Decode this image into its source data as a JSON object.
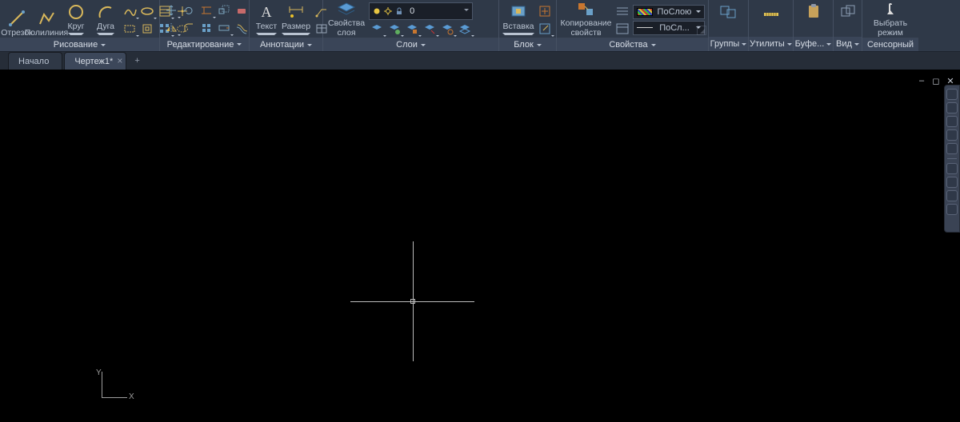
{
  "ribbon": {
    "draw": {
      "title": "Рисование",
      "line": "Отрезок",
      "polyline": "Полилиния",
      "circle": "Круг",
      "arc": "Дуга"
    },
    "edit": {
      "title": "Редактирование"
    },
    "annot": {
      "title": "Аннотации",
      "text": "Текст",
      "dim": "Размер"
    },
    "layers": {
      "title": "Слои",
      "big": "Свойства\nслоя",
      "current": "0"
    },
    "block": {
      "title": "Блок",
      "insert": "Вставка"
    },
    "props": {
      "title": "Свойства",
      "big": "Копирование\nсвойств",
      "bylayer1": "ПоСлою",
      "bylayer2": "ПоСл..."
    },
    "groups": "Группы",
    "utils": "Утилиты",
    "clip": "Буфе...",
    "view": "Вид",
    "touch_btn": "Выбрать\nрежим",
    "touch_title": "Сенсорный"
  },
  "tabs": {
    "start": "Начало",
    "drawing": "Чертеж1*"
  },
  "ucs": {
    "x": "X",
    "y": "Y"
  }
}
